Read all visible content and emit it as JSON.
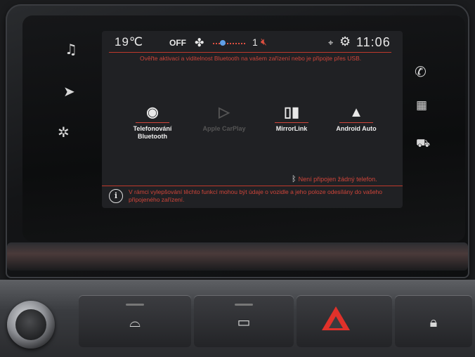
{
  "status_bar": {
    "temperature": "19℃",
    "ac_state": "OFF",
    "fan_icon": "fan-icon",
    "volume_level": "1",
    "mute_icon": "speaker-muted-icon",
    "location_icon": "location-pin-icon",
    "settings_icon": "gear-icon",
    "time": "11:06"
  },
  "banner": {
    "message": "Ověřte aktivaci a viditelnost Bluetooth na vašem zařízení nebo je připojte přes USB."
  },
  "side_menu_left": [
    {
      "icon": "music-note-icon"
    },
    {
      "icon": "navigation-icon"
    },
    {
      "icon": "fan-settings-icon"
    }
  ],
  "side_menu_right": [
    {
      "icon": "phone-icon"
    },
    {
      "icon": "apps-grid-icon"
    },
    {
      "icon": "car-icon"
    }
  ],
  "apps": [
    {
      "label_line1": "Telefonování",
      "label_line2": "Bluetooth",
      "icon": "bluetooth-icon",
      "enabled": true
    },
    {
      "label_line1": "Apple CarPlay",
      "label_line2": "",
      "icon": "play-icon",
      "enabled": false
    },
    {
      "label_line1": "MirrorLink",
      "label_line2": "",
      "icon": "mirrorlink-icon",
      "enabled": true
    },
    {
      "label_line1": "Android Auto",
      "label_line2": "",
      "icon": "android-auto-icon",
      "enabled": true
    }
  ],
  "bluetooth_status": "Není připojen žádný telefon.",
  "info_message": "V rámci vylepšování těchto funkcí mohou být údaje o vozidle a jeho poloze odesílány do vašeho připojeného zařízení.",
  "colors": {
    "accent_red": "#d0453a",
    "screen_bg": "#202124",
    "hazard_red": "#e0312a"
  },
  "physical_buttons": [
    {
      "name": "volume-knob"
    },
    {
      "name": "front-defrost",
      "icon": "front-defrost-icon"
    },
    {
      "name": "rear-defrost",
      "icon": "rear-defrost-icon"
    },
    {
      "name": "hazard",
      "icon": "hazard-triangle-icon"
    },
    {
      "name": "door-lock",
      "icon": "lock-icon"
    }
  ]
}
